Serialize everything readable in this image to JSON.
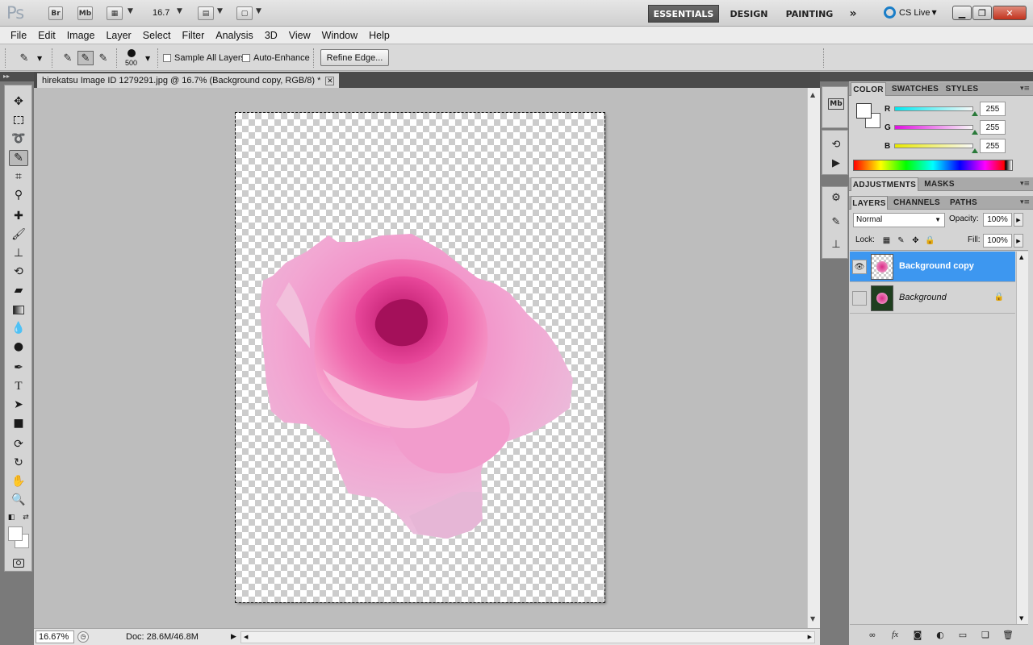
{
  "appbar": {
    "logo": "Ps",
    "bridge": "Br",
    "minibridge": "Mb",
    "zoom": "16.7",
    "workspaces": [
      "ESSENTIALS",
      "DESIGN",
      "PAINTING"
    ],
    "more": "»",
    "cslive": "CS Live"
  },
  "menu": [
    "File",
    "Edit",
    "Image",
    "Layer",
    "Select",
    "Filter",
    "Analysis",
    "3D",
    "View",
    "Window",
    "Help"
  ],
  "options": {
    "brush_size": "500",
    "sample_all_layers": "Sample All Layers",
    "auto_enhance": "Auto-Enhance",
    "refine_edge": "Refine Edge..."
  },
  "document": {
    "tab_title": "hirekatsu Image ID 1279291.jpg @ 16.7% (Background copy, RGB/8) *",
    "zoom": "16.67%",
    "doc_info": "Doc: 28.6M/46.8M"
  },
  "color_panel": {
    "tabs": [
      "COLOR",
      "SWATCHES",
      "STYLES"
    ],
    "channels": [
      {
        "label": "R",
        "value": "255",
        "color": "#00d8e0"
      },
      {
        "label": "G",
        "value": "255",
        "color": "#e020e0"
      },
      {
        "label": "B",
        "value": "255",
        "color": "#e8e800"
      }
    ]
  },
  "adjust_panel": {
    "tabs": [
      "ADJUSTMENTS",
      "MASKS"
    ]
  },
  "layers_panel": {
    "tabs": [
      "LAYERS",
      "CHANNELS",
      "PATHS"
    ],
    "blend_mode": "Normal",
    "opacity_label": "Opacity:",
    "opacity": "100%",
    "lock_label": "Lock:",
    "fill_label": "Fill:",
    "fill": "100%",
    "layers": [
      {
        "name": "Background copy",
        "selected": true
      },
      {
        "name": "Background",
        "selected": false
      }
    ],
    "selection_color": "#3d97f0"
  }
}
